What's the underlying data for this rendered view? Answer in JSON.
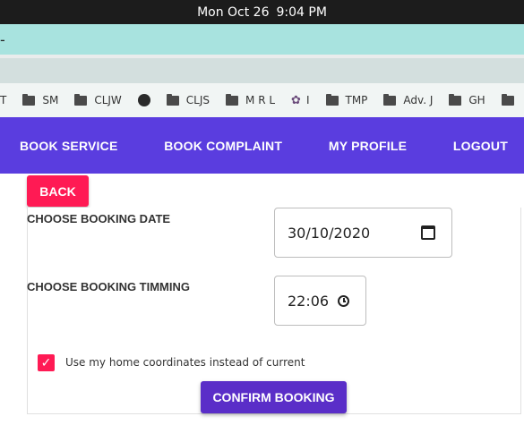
{
  "system": {
    "date": "Mon Oct 26",
    "time": "9:04 PM"
  },
  "browser": {
    "address_fragment": "-",
    "bookmarks": [
      {
        "label": "T",
        "icon": "none"
      },
      {
        "label": "SM",
        "icon": "folder-icon"
      },
      {
        "label": "CLJW",
        "icon": "folder-icon"
      },
      {
        "label": "",
        "icon": "globe-icon"
      },
      {
        "label": "CLJS",
        "icon": "folder-icon"
      },
      {
        "label": "M R L",
        "icon": "folder-icon"
      },
      {
        "label": "I",
        "icon": "flower-icon"
      },
      {
        "label": "TMP",
        "icon": "folder-icon"
      },
      {
        "label": "Adv. J",
        "icon": "folder-icon"
      },
      {
        "label": "GH",
        "icon": "folder-icon"
      }
    ]
  },
  "nav": {
    "book_service": "BOOK SERVICE",
    "book_complaint": "BOOK COMPLAINT",
    "my_profile": "MY PROFILE",
    "logout": "LOGOUT"
  },
  "form": {
    "back_label": "BACK",
    "date_label": "CHOOSE BOOKING DATE",
    "date_value": "30/10/2020",
    "time_label": "CHOOSE BOOKING TIMMING",
    "time_value": "22:06",
    "checkbox_checked": true,
    "checkbox_label": "Use my home coordinates instead of current",
    "confirm_label": "CONFIRM BOOKING"
  },
  "colors": {
    "nav_bg": "#5a3ddf",
    "accent_pink": "#ff1a54",
    "confirm_bg": "#5a2ec8",
    "teal_bar": "#a8e3df"
  }
}
